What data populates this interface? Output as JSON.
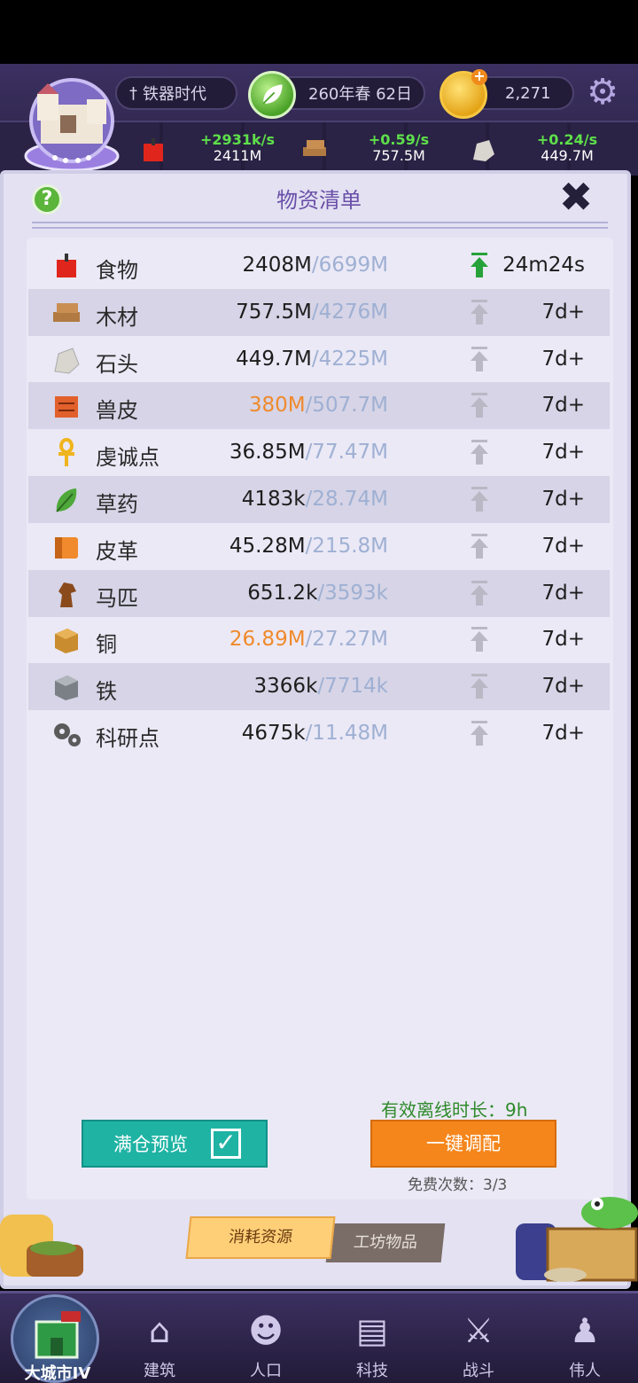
{
  "header": {
    "age": "铁器时代",
    "date": "260年春 62日",
    "gold": "2,271",
    "resources": [
      {
        "icon": "food-icon",
        "rate": "+2931k/s",
        "amount": "2411M"
      },
      {
        "icon": "wood-icon",
        "rate": "+0.59/s",
        "amount": "757.5M"
      },
      {
        "icon": "stone-icon",
        "rate": "+0.24/s",
        "amount": "449.7M"
      }
    ]
  },
  "panel": {
    "title": "物资清单",
    "rows": [
      {
        "icon": "food-icon",
        "name": "食物",
        "current": "2408M",
        "cap": "/6699M",
        "time": "24m24s",
        "warn": false
      },
      {
        "icon": "wood-icon",
        "name": "木材",
        "current": "757.5M",
        "cap": "/4276M",
        "time": "7d+",
        "warn": false
      },
      {
        "icon": "stone-icon",
        "name": "石头",
        "current": "449.7M",
        "cap": "/4225M",
        "time": "7d+",
        "warn": false
      },
      {
        "icon": "hide-icon",
        "name": "兽皮",
        "current": "380M",
        "cap": "/507.7M",
        "time": "7d+",
        "warn": true
      },
      {
        "icon": "ankh-icon",
        "name": "虔诚点",
        "current": "36.85M",
        "cap": "/77.47M",
        "time": "7d+",
        "warn": false
      },
      {
        "icon": "herb-icon",
        "name": "草药",
        "current": "4183k",
        "cap": "/28.74M",
        "time": "7d+",
        "warn": false
      },
      {
        "icon": "leather-icon",
        "name": "皮革",
        "current": "45.28M",
        "cap": "/215.8M",
        "time": "7d+",
        "warn": false
      },
      {
        "icon": "horse-icon",
        "name": "马匹",
        "current": "651.2k",
        "cap": "/3593k",
        "time": "7d+",
        "warn": false
      },
      {
        "icon": "copper-icon",
        "name": "铜",
        "current": "26.89M",
        "cap": "/27.27M",
        "time": "7d+",
        "warn": true
      },
      {
        "icon": "iron-icon",
        "name": "铁",
        "current": "3366k",
        "cap": "/7714k",
        "time": "7d+",
        "warn": false
      },
      {
        "icon": "research-icon",
        "name": "科研点",
        "current": "4675k",
        "cap": "/11.48M",
        "time": "7d+",
        "warn": false
      }
    ],
    "offline_time": "有效离线时长：9h",
    "preview_button": "满仓预览",
    "adjust_button": "一键调配",
    "free_count": "免费次数：3/3",
    "tab_consume": "消耗资源",
    "tab_workshop": "工坊物品"
  },
  "nav": {
    "items": [
      "大城市IV",
      "建筑",
      "人口",
      "科技",
      "战斗",
      "伟人"
    ]
  },
  "colors": {
    "warn": "#f08a2c",
    "cap": "#9fb0d3",
    "accent_teal": "#1fb3a4",
    "accent_orange": "#f5861c"
  }
}
